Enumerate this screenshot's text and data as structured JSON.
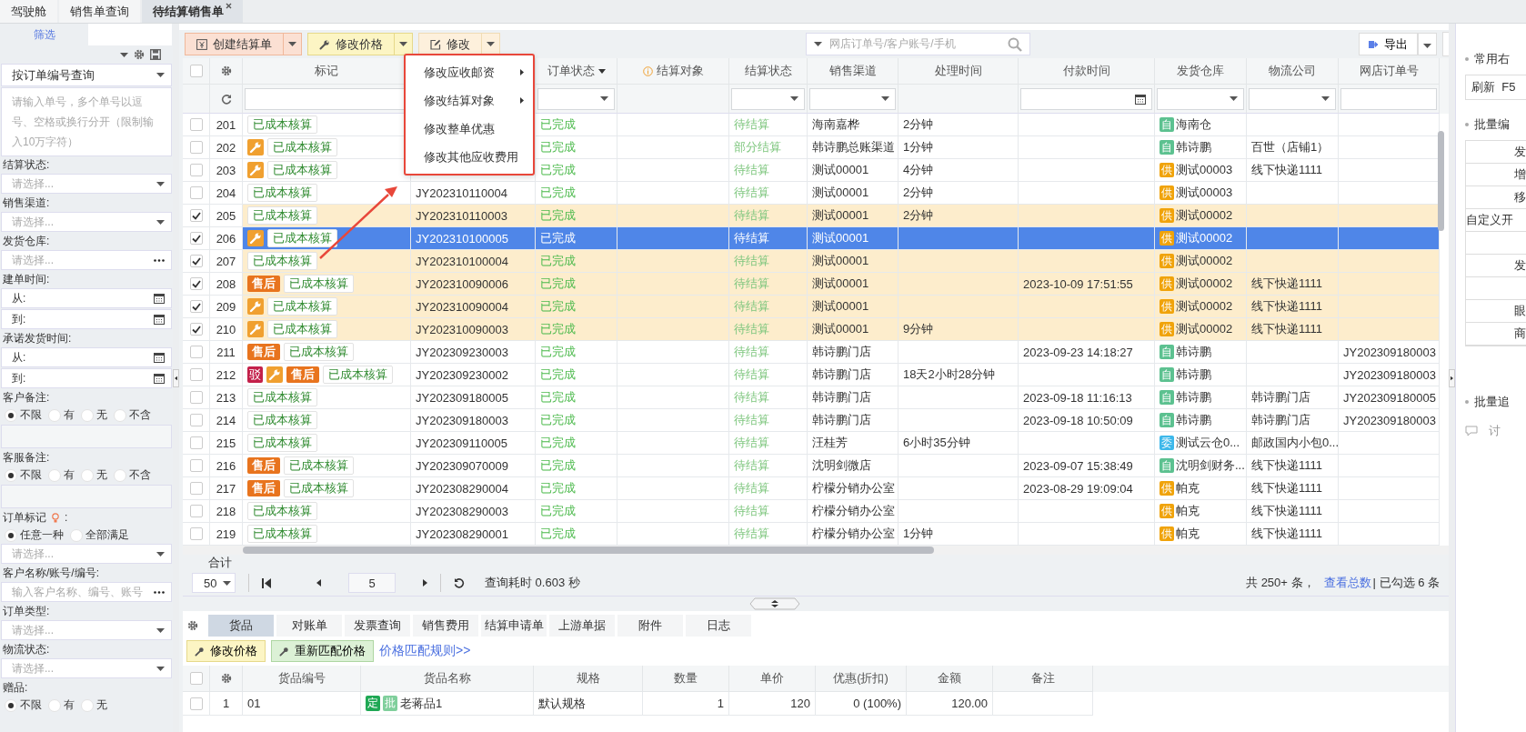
{
  "tabs": [
    {
      "label": "驾驶舱",
      "selected": false,
      "closable": false
    },
    {
      "label": "销售单查询",
      "selected": false,
      "closable": false
    },
    {
      "label": "待结算销售单",
      "selected": true,
      "closable": true
    }
  ],
  "sidebar": {
    "tab": "筛选",
    "query_mode": "按订单编号查询",
    "query_placeholder": "请输入单号，多个单号以逗号、空格或换行分开（限制输入10万字符）",
    "fields": [
      {
        "kind": "select",
        "label": "结算状态:",
        "placeholder": "请选择..."
      },
      {
        "kind": "select",
        "label": "销售渠道:",
        "placeholder": "请选择..."
      },
      {
        "kind": "picker",
        "label": "发货仓库:",
        "placeholder": "请选择..."
      },
      {
        "kind": "dates",
        "label": "建单时间:",
        "from": "从:",
        "to": "到:"
      },
      {
        "kind": "dates",
        "label": "承诺发货时间:",
        "from": "从:",
        "to": "到:"
      },
      {
        "kind": "radio_note",
        "label": "客户备注:",
        "options": [
          {
            "label": "不限",
            "selected": true
          },
          {
            "label": "有",
            "selected": false
          },
          {
            "label": "无",
            "selected": false
          },
          {
            "label": "不含",
            "selected": false
          }
        ]
      },
      {
        "kind": "radio_note",
        "label": "客服备注:",
        "options": [
          {
            "label": "不限",
            "selected": true
          },
          {
            "label": "有",
            "selected": false
          },
          {
            "label": "无",
            "selected": false
          },
          {
            "label": "不含",
            "selected": false
          }
        ]
      },
      {
        "kind": "radio_select",
        "label": "订单标记",
        "suffix": ":",
        "placeholder": "请选择...",
        "options": [
          {
            "label": "任意一种",
            "selected": true
          },
          {
            "label": "全部满足",
            "selected": false
          }
        ]
      },
      {
        "kind": "picker",
        "label": "客户名称/账号/编号:",
        "placeholder": "输入客户名称、编号、账号"
      },
      {
        "kind": "select",
        "label": "订单类型:",
        "placeholder": "请选择..."
      },
      {
        "kind": "select",
        "label": "物流状态:",
        "placeholder": "请选择..."
      },
      {
        "kind": "radio",
        "label": "赠品:",
        "options": [
          {
            "label": "不限",
            "selected": true
          },
          {
            "label": "有",
            "selected": false
          },
          {
            "label": "无",
            "selected": false
          }
        ]
      }
    ]
  },
  "toolbar": {
    "buttons": [
      {
        "label": "创建结算单",
        "kind": "create"
      },
      {
        "label": "修改价格",
        "kind": "price"
      },
      {
        "label": "修改",
        "kind": "edit"
      }
    ],
    "search_placeholder": "网店订单号/客户账号/手机",
    "export": "导出"
  },
  "menu": [
    {
      "label": "修改应收邮资",
      "submenu": true
    },
    {
      "label": "修改结算对象",
      "submenu": true
    },
    {
      "label": "修改整单优惠",
      "submenu": false
    },
    {
      "label": "修改其他应收费用",
      "submenu": false
    }
  ],
  "all_checked": false,
  "columns": [
    {
      "label": "标记",
      "kind": "text"
    },
    {
      "kind": "text"
    },
    {
      "label": "订单状态",
      "kind": "select",
      "sortable": true
    },
    {
      "label": "结算对象",
      "kind": "none",
      "info": true
    },
    {
      "label": "结算状态",
      "kind": "select"
    },
    {
      "label": "销售渠道",
      "kind": "select"
    },
    {
      "label": "处理时间",
      "kind": "none"
    },
    {
      "label": "付款时间",
      "kind": "date"
    },
    {
      "label": "发货仓库",
      "kind": "select"
    },
    {
      "label": "物流公司",
      "kind": "select"
    },
    {
      "label": "网店订单号",
      "kind": "text"
    }
  ],
  "rows": [
    {
      "no": "201",
      "checked": false,
      "selected": false,
      "tags": [
        {
          "kind": "cost",
          "text": "已成本核算"
        }
      ],
      "status": "已完成",
      "settle": "待结算",
      "channel": "海南嘉桦",
      "process": "2分钟",
      "wh": {
        "kind": "self",
        "mark": "自",
        "name": "海南仓"
      }
    },
    {
      "no": "202",
      "checked": false,
      "selected": false,
      "tags": [
        {
          "kind": "wrench"
        },
        {
          "kind": "cost",
          "text": "已成本核算"
        }
      ],
      "status": "已完成",
      "settle": "部分结算",
      "channel": "韩诗鹏总账渠道",
      "process": "1分钟",
      "wh": {
        "kind": "self",
        "mark": "自",
        "name": "韩诗鹏"
      },
      "logistics": "百世（店铺1）"
    },
    {
      "no": "203",
      "checked": false,
      "selected": false,
      "tags": [
        {
          "kind": "wrench"
        },
        {
          "kind": "cost",
          "text": "已成本核算"
        }
      ],
      "status": "已完成",
      "settle": "待结算",
      "channel": "测试00001",
      "process": "4分钟",
      "wh": {
        "kind": "supply",
        "mark": "供",
        "name": "测试00003"
      },
      "logistics": "线下快递1111"
    },
    {
      "no": "204",
      "checked": false,
      "selected": false,
      "tags": [
        {
          "kind": "cost",
          "text": "已成本核算"
        }
      ],
      "order": "JY202310110004",
      "status": "已完成",
      "settle": "待结算",
      "channel": "测试00001",
      "process": "2分钟",
      "wh": {
        "kind": "supply",
        "mark": "供",
        "name": "测试00003"
      }
    },
    {
      "no": "205",
      "checked": true,
      "selected": false,
      "tags": [
        {
          "kind": "cost",
          "text": "已成本核算"
        }
      ],
      "order": "JY202310110003",
      "status": "已完成",
      "settle": "待结算",
      "channel": "测试00001",
      "process": "2分钟",
      "wh": {
        "kind": "supply",
        "mark": "供",
        "name": "测试00002"
      }
    },
    {
      "no": "206",
      "checked": true,
      "selected": true,
      "tags": [
        {
          "kind": "wrench"
        },
        {
          "kind": "cost",
          "text": "已成本核算"
        }
      ],
      "order": "JY202310100005",
      "status": "已完成",
      "settle": "待结算",
      "channel": "测试00001",
      "wh": {
        "kind": "supply",
        "mark": "供",
        "name": "测试00002"
      }
    },
    {
      "no": "207",
      "checked": true,
      "selected": false,
      "tags": [
        {
          "kind": "cost",
          "text": "已成本核算"
        }
      ],
      "order": "JY202310100004",
      "status": "已完成",
      "settle": "待结算",
      "channel": "测试00001",
      "wh": {
        "kind": "supply",
        "mark": "供",
        "name": "测试00002"
      }
    },
    {
      "no": "208",
      "checked": true,
      "selected": false,
      "tags": [
        {
          "kind": "after_sale",
          "text": "售后"
        },
        {
          "kind": "cost",
          "text": "已成本核算"
        }
      ],
      "order": "JY202310090006",
      "status": "已完成",
      "settle": "待结算",
      "channel": "测试00001",
      "pay": "2023-10-09 17:51:55",
      "wh": {
        "kind": "supply",
        "mark": "供",
        "name": "测试00002"
      },
      "logistics": "线下快递1111"
    },
    {
      "no": "209",
      "checked": true,
      "selected": false,
      "tags": [
        {
          "kind": "wrench"
        },
        {
          "kind": "cost",
          "text": "已成本核算"
        }
      ],
      "order": "JY202310090004",
      "status": "已完成",
      "settle": "待结算",
      "channel": "测试00001",
      "wh": {
        "kind": "supply",
        "mark": "供",
        "name": "测试00002"
      },
      "logistics": "线下快递1111"
    },
    {
      "no": "210",
      "checked": true,
      "selected": false,
      "tags": [
        {
          "kind": "wrench"
        },
        {
          "kind": "cost",
          "text": "已成本核算"
        }
      ],
      "order": "JY202310090003",
      "status": "已完成",
      "settle": "待结算",
      "channel": "测试00001",
      "process": "9分钟",
      "wh": {
        "kind": "supply",
        "mark": "供",
        "name": "测试00002"
      },
      "logistics": "线下快递1111"
    },
    {
      "no": "211",
      "checked": false,
      "selected": false,
      "tags": [
        {
          "kind": "after_sale",
          "text": "售后"
        },
        {
          "kind": "cost",
          "text": "已成本核算"
        }
      ],
      "order": "JY202309230003",
      "status": "已完成",
      "settle": "待结算",
      "channel": "韩诗鹏门店",
      "pay": "2023-09-23 14:18:27",
      "wh": {
        "kind": "self",
        "mark": "自",
        "name": "韩诗鹏"
      },
      "shop": "JY202309180003"
    },
    {
      "no": "212",
      "checked": false,
      "selected": false,
      "tags": [
        {
          "kind": "reject",
          "text": "驳"
        },
        {
          "kind": "wrench"
        },
        {
          "kind": "after_sale",
          "text": "售后"
        },
        {
          "kind": "cost",
          "text": "已成本核算"
        }
      ],
      "order": "JY202309230002",
      "status": "已完成",
      "settle": "待结算",
      "channel": "韩诗鹏门店",
      "process": "18天2小时28分钟",
      "wh": {
        "kind": "self",
        "mark": "自",
        "name": "韩诗鹏"
      },
      "shop": "JY202309180003"
    },
    {
      "no": "213",
      "checked": false,
      "selected": false,
      "tags": [
        {
          "kind": "cost",
          "text": "已成本核算"
        }
      ],
      "order": "JY202309180005",
      "status": "已完成",
      "settle": "待结算",
      "channel": "韩诗鹏门店",
      "pay": "2023-09-18 11:16:13",
      "wh": {
        "kind": "self",
        "mark": "自",
        "name": "韩诗鹏"
      },
      "logistics": "韩诗鹏门店",
      "shop": "JY202309180005"
    },
    {
      "no": "214",
      "checked": false,
      "selected": false,
      "tags": [
        {
          "kind": "cost",
          "text": "已成本核算"
        }
      ],
      "order": "JY202309180003",
      "status": "已完成",
      "settle": "待结算",
      "channel": "韩诗鹏门店",
      "pay": "2023-09-18 10:50:09",
      "wh": {
        "kind": "self",
        "mark": "自",
        "name": "韩诗鹏"
      },
      "logistics": "韩诗鹏门店",
      "shop": "JY202309180003"
    },
    {
      "no": "215",
      "checked": false,
      "selected": false,
      "tags": [
        {
          "kind": "cost",
          "text": "已成本核算"
        }
      ],
      "order": "JY202309110005",
      "status": "已完成",
      "settle": "待结算",
      "channel": "汪桂芳",
      "process": "6小时35分钟",
      "wh": {
        "kind": "consign",
        "mark": "委",
        "name": "测试云仓0..."
      },
      "logistics": "邮政国内小包0..."
    },
    {
      "no": "216",
      "checked": false,
      "selected": false,
      "tags": [
        {
          "kind": "after_sale",
          "text": "售后"
        },
        {
          "kind": "cost",
          "text": "已成本核算"
        }
      ],
      "order": "JY202309070009",
      "status": "已完成",
      "settle": "待结算",
      "channel": "沈明剑微店",
      "pay": "2023-09-07 15:38:49",
      "wh": {
        "kind": "self",
        "mark": "自",
        "name": "沈明剑财务..."
      },
      "logistics": "线下快递1111"
    },
    {
      "no": "217",
      "checked": false,
      "selected": false,
      "tags": [
        {
          "kind": "after_sale",
          "text": "售后"
        },
        {
          "kind": "cost",
          "text": "已成本核算"
        }
      ],
      "order": "JY202308290004",
      "status": "已完成",
      "settle": "待结算",
      "channel": "柠檬分销办公室",
      "pay": "2023-08-29 19:09:04",
      "wh": {
        "kind": "supply",
        "mark": "供",
        "name": "帕克"
      },
      "logistics": "线下快递1111"
    },
    {
      "no": "218",
      "checked": false,
      "selected": false,
      "tags": [
        {
          "kind": "cost",
          "text": "已成本核算"
        }
      ],
      "order": "JY202308290003",
      "status": "已完成",
      "settle": "待结算",
      "channel": "柠檬分销办公室",
      "wh": {
        "kind": "supply",
        "mark": "供",
        "name": "帕克"
      },
      "logistics": "线下快递1111"
    },
    {
      "no": "219",
      "checked": false,
      "selected": false,
      "tags": [
        {
          "kind": "cost",
          "text": "已成本核算"
        }
      ],
      "order": "JY202308290001",
      "status": "已完成",
      "settle": "待结算",
      "channel": "柠檬分销办公室",
      "process": "1分钟",
      "wh": {
        "kind": "supply",
        "mark": "供",
        "name": "帕克"
      },
      "logistics": "线下快递1111"
    }
  ],
  "total_label": "合计",
  "pager": {
    "size": "50",
    "page": "5",
    "time": "查询耗时 0.603 秒",
    "total": "共 250+ 条，",
    "total_link": "查看总数",
    "checked": "| 已勾选 6 条"
  },
  "detail_tabs": [
    {
      "label": "货品",
      "selected": true
    },
    {
      "label": "对账单",
      "selected": false
    },
    {
      "label": "发票查询",
      "selected": false
    },
    {
      "label": "销售费用",
      "selected": false
    },
    {
      "label": "结算申请单",
      "selected": false
    },
    {
      "label": "上游单据",
      "selected": false
    },
    {
      "label": "附件",
      "selected": false
    },
    {
      "label": "日志",
      "selected": false
    }
  ],
  "detail_buttons": [
    {
      "label": "修改价格",
      "kind": "price"
    },
    {
      "label": "重新匹配价格",
      "kind": "rematch"
    }
  ],
  "detail_link": "价格匹配规则>>",
  "goods_all_checked": false,
  "goods_columns": [
    "货品编号",
    "货品名称",
    "规格",
    "数量",
    "单价",
    "优惠(折扣)",
    "金额",
    "备注"
  ],
  "goods_rows": [
    {
      "no": "1",
      "checked": false,
      "code": "01",
      "tags": [
        {
          "kind": "fixed",
          "text": "定"
        },
        {
          "kind": "batch",
          "text": "批"
        }
      ],
      "name": "老蒋品1",
      "spec": "默认规格",
      "qty": "1",
      "price": "120",
      "discount": "0 (100%)",
      "amount": "120.00"
    }
  ],
  "right_panel": {
    "sections": [
      {
        "title": "常用右",
        "items": [
          "刷新  F5"
        ]
      },
      {
        "title": "批量编",
        "grid": [
          {
            "text": "发"
          },
          {
            "text": "增"
          },
          {
            "text": "移"
          },
          {
            "text": "自定义开",
            "left": true
          },
          {
            "text": "发",
            "blank_before": true
          },
          {
            "text": "眼",
            "blank_before": true
          },
          {
            "text": "商"
          }
        ]
      },
      {
        "title": "批量追"
      }
    ],
    "discuss": "讨"
  }
}
